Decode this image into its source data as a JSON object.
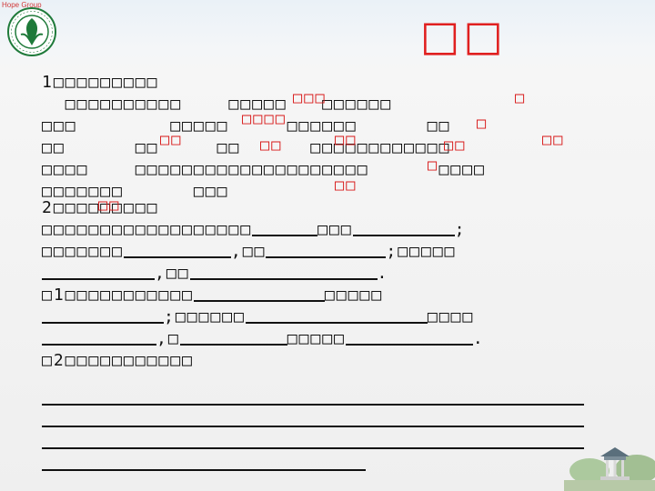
{
  "brand": {
    "text": "Hope Group"
  },
  "title": "□□",
  "colors": {
    "accent_red": "#e02020",
    "text": "#111111",
    "logo_green": "#1f7a3a"
  },
  "logo": {
    "name": "university-seal",
    "text": "中山大学 SUN YAT-SEN UNIVERSITY"
  },
  "section1": {
    "heading": "1□□□□□□□□□",
    "lines": [
      "  □□□□□□□□□□    □□□□□   □□□□□□",
      "□□□        □□□□□     □□□□□□      □□",
      "□□      □□     □□      □□□□□□□□□□□□",
      "□□□□    □□□□□□□□□□□□□□□□□□□□      □□□□",
      "□□□□□□□      □□□"
    ],
    "red_labels": [
      "□□□",
      "□",
      "□□□□",
      "□",
      "□□",
      "□□",
      "□□",
      "□□",
      "□□",
      "□",
      "□□"
    ]
  },
  "section2": {
    "heading": "2□□□□□□□□□",
    "red_label": "□□",
    "line1": {
      "text": "□□□□□□□□□□□□□□□□□□",
      "mid": "□□□"
    },
    "line2": {
      "a": "□□□□□□□",
      "b": ",□□",
      "end": ";□□□□□"
    },
    "line3": {
      "a": ",□□",
      "end": "."
    },
    "q1": {
      "a": "□1□□□□□□□□□□□",
      "b": "□□□□□"
    },
    "q1_line2": {
      "a": ";□□□□□□",
      "b": "□□□□"
    },
    "q1_line3": {
      "a": ",□",
      "b": "□□□□□",
      "end": "."
    },
    "q2": {
      "text": "□2□□□□□□□□□□□"
    }
  },
  "decor": {
    "pavilion_icon": "pavilion-image"
  }
}
